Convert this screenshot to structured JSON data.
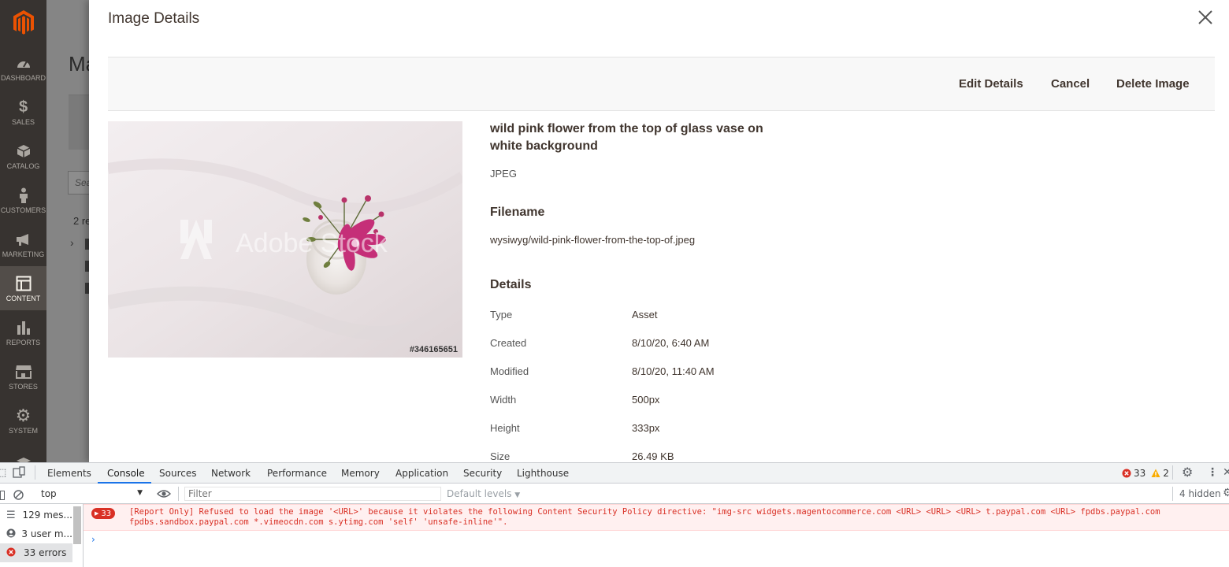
{
  "sidebar": {
    "items": [
      {
        "label": "DASHBOARD",
        "icon": "dashboard-icon"
      },
      {
        "label": "SALES",
        "icon": "dollar-icon"
      },
      {
        "label": "CATALOG",
        "icon": "cube-icon"
      },
      {
        "label": "CUSTOMERS",
        "icon": "person-icon"
      },
      {
        "label": "MARKETING",
        "icon": "megaphone-icon"
      },
      {
        "label": "CONTENT",
        "icon": "layout-icon"
      },
      {
        "label": "REPORTS",
        "icon": "bar-chart-icon"
      },
      {
        "label": "STORES",
        "icon": "store-icon"
      },
      {
        "label": "SYSTEM",
        "icon": "gear-icon"
      }
    ]
  },
  "background_page": {
    "title": "Ma",
    "search_placeholder": "Sea",
    "records": "2 re"
  },
  "modal": {
    "title": "Image Details",
    "actions": {
      "edit": "Edit Details",
      "cancel": "Cancel",
      "delete": "Delete Image"
    },
    "preview": {
      "watermark": "Adobe Stock",
      "stock_id": "#346165651"
    },
    "asset": {
      "title": "wild pink flower from the top of glass vase on white background",
      "format": "JPEG"
    },
    "filename": {
      "heading": "Filename",
      "value": "wysiwyg/wild-pink-flower-from-the-top-of.jpeg"
    },
    "details": {
      "heading": "Details",
      "rows": [
        {
          "key": "Type",
          "value": "Asset"
        },
        {
          "key": "Created",
          "value": "8/10/20, 6:40 AM"
        },
        {
          "key": "Modified",
          "value": "8/10/20, 11:40 AM"
        },
        {
          "key": "Width",
          "value": "500px"
        },
        {
          "key": "Height",
          "value": "333px"
        },
        {
          "key": "Size",
          "value": "26.49 KB"
        }
      ]
    }
  },
  "devtools": {
    "tabs": [
      "Elements",
      "Console",
      "Sources",
      "Network",
      "Performance",
      "Memory",
      "Application",
      "Security",
      "Lighthouse"
    ],
    "active_tab": "Console",
    "error_count": "33",
    "warning_count": "2",
    "context": "top",
    "filter_placeholder": "Filter",
    "levels": "Default levels",
    "hidden": "4 hidden",
    "side": {
      "messages": "129 mes...",
      "user_messages": "3 user m...",
      "errors": "33 errors"
    },
    "error": {
      "badge": "33",
      "message": "[Report Only] Refused to load the image '<URL>' because it violates the following Content Security Policy directive: \"img-src widgets.magentocommerce.com <URL> <URL> <URL> t.paypal.com <URL> fpdbs.paypal.com fpdbs.sandbox.paypal.com *.vimeocdn.com s.ytimg.com 'self' 'unsafe-inline'\"."
    },
    "prompt": "›"
  },
  "colors": {
    "sidebar_bg": "#373330",
    "magento_orange": "#eb5202",
    "error_red": "#d93025",
    "warning_yellow": "#f9ab00",
    "devtools_blue": "#1a73e8"
  }
}
